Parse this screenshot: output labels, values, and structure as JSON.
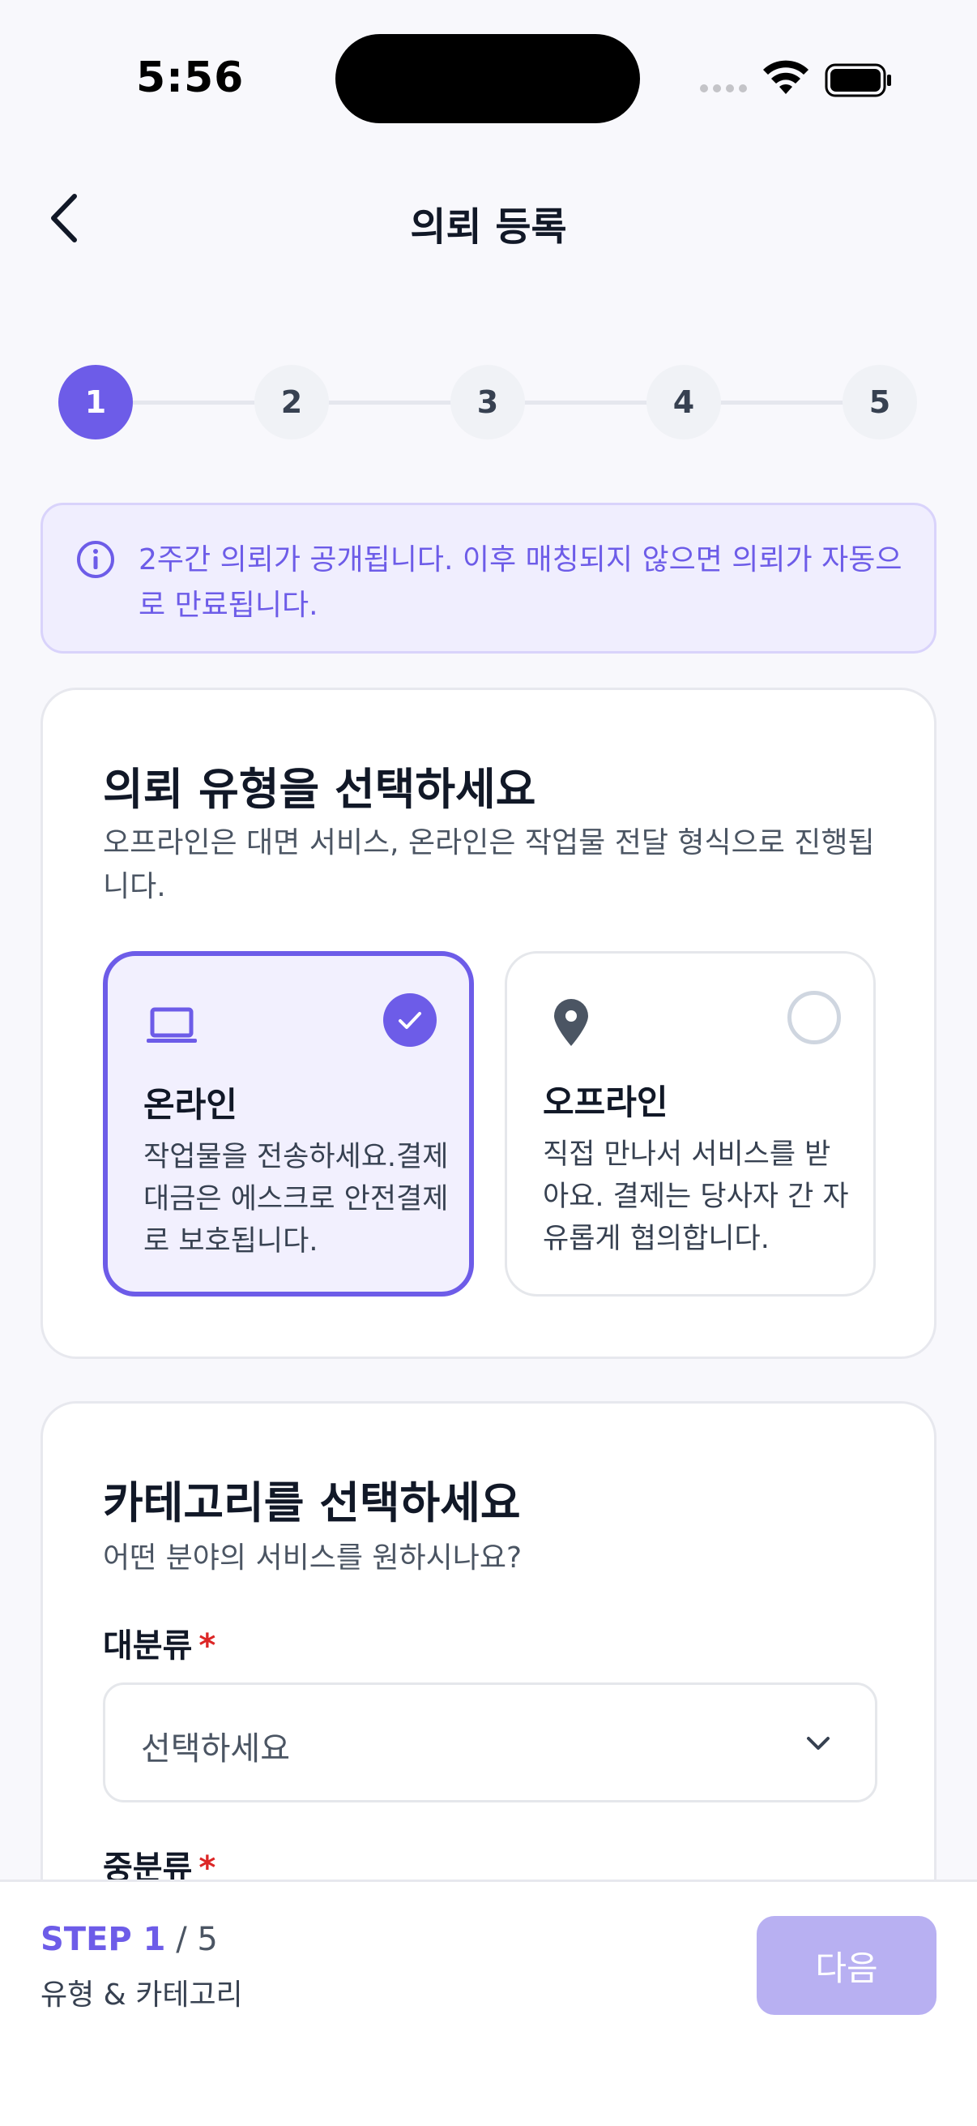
{
  "status_bar": {
    "time": "5:56"
  },
  "nav": {
    "title": "의뢰 등록"
  },
  "stepper": {
    "steps": [
      "1",
      "2",
      "3",
      "4",
      "5"
    ],
    "active_index": 0
  },
  "notice": {
    "text": "2주간 의뢰가 공개됩니다. 이후 매칭되지 않으면 의뢰가 자동으로 만료됩니다."
  },
  "type_card": {
    "title": "의뢰 유형을 선택하세요",
    "subtitle": "오프라인은 대면 서비스, 온라인은 작업물 전달 형식으로 진행됩니다.",
    "options": [
      {
        "title": "온라인",
        "desc": "작업물을 전송하세요.결제 대금은 에스크로 안전결제로 보호됩니다.",
        "icon": "laptop-icon",
        "selected": true
      },
      {
        "title": "오프라인",
        "desc": "직접 만나서 서비스를 받아요. 결제는 당사자 간 자유롭게 협의합니다.",
        "icon": "location-pin-icon",
        "selected": false
      }
    ]
  },
  "category_card": {
    "title": "카테고리를 선택하세요",
    "subtitle": "어떤 분야의 서비스를 원하시나요?",
    "major_label": "대분류",
    "major_placeholder": "선택하세요",
    "minor_label": "중분류",
    "required_mark": "*"
  },
  "bottom_bar": {
    "step_label": "STEP 1",
    "step_total": " / 5",
    "caption": "유형 & 카테고리",
    "next_label": "다음"
  },
  "colors": {
    "accent": "#6d5ce8",
    "accent_light": "#f2f0fe",
    "disabled_button": "#b8b0f2",
    "required": "#dc2626"
  }
}
